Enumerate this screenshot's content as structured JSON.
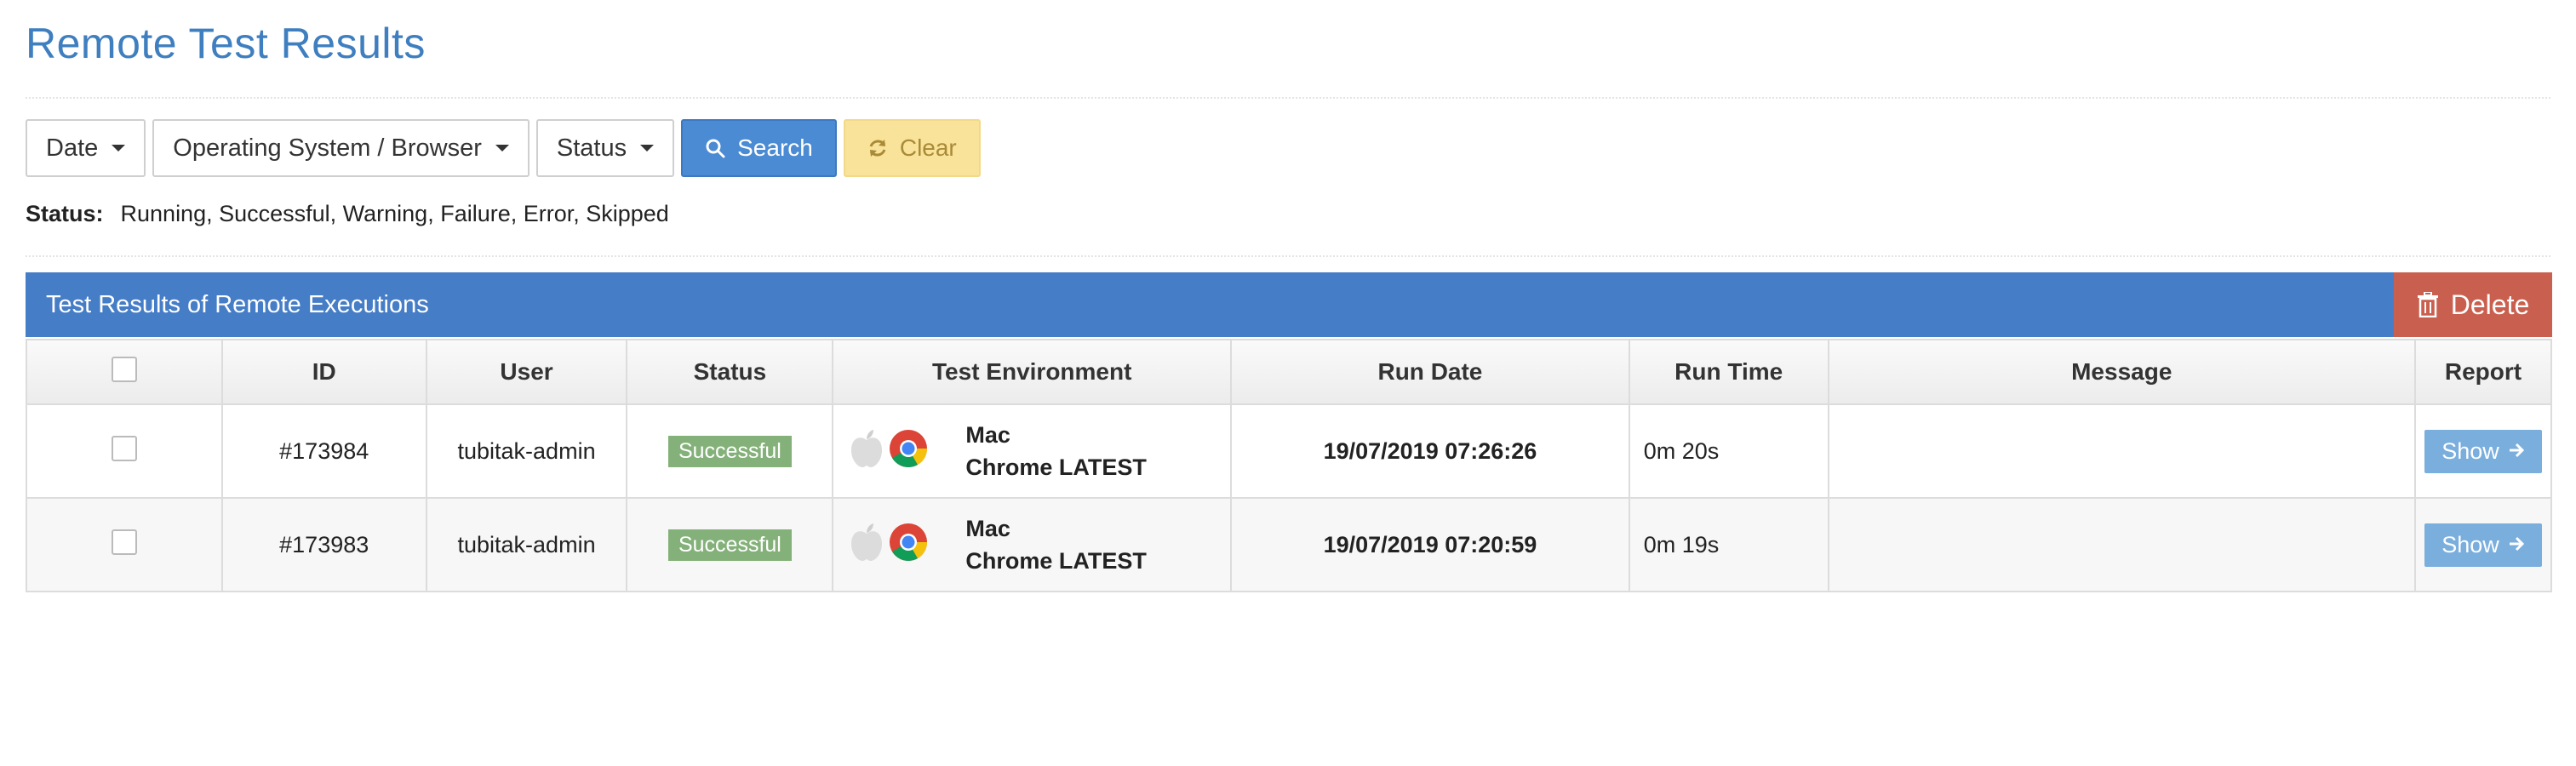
{
  "page": {
    "title": "Remote Test Results"
  },
  "filters": {
    "date_label": "Date",
    "os_browser_label": "Operating System / Browser",
    "status_label": "Status",
    "search_label": "Search",
    "clear_label": "Clear"
  },
  "status_line": {
    "label": "Status:",
    "value": "Running, Successful, Warning, Failure, Error, Skipped"
  },
  "panel": {
    "title": "Test Results of Remote Executions",
    "delete_label": "Delete"
  },
  "table": {
    "headers": [
      "ID",
      "User",
      "Status",
      "Test Environment",
      "Run Date",
      "Run Time",
      "Message",
      "Report"
    ],
    "rows": [
      {
        "id": "#173984",
        "user": "tubitak-admin",
        "status": "Successful",
        "os": "Mac",
        "browser": "Chrome LATEST",
        "run_date": "19/07/2019 07:26:26",
        "run_time": "0m 20s",
        "message": "",
        "report_label": "Show"
      },
      {
        "id": "#173983",
        "user": "tubitak-admin",
        "status": "Successful",
        "os": "Mac",
        "browser": "Chrome LATEST",
        "run_date": "19/07/2019 07:20:59",
        "run_time": "0m 19s",
        "message": "",
        "report_label": "Show"
      }
    ]
  },
  "icons": {
    "os": "apple-icon",
    "browser": "chrome-icon",
    "search": "search-icon",
    "clear": "refresh-icon",
    "delete": "trash-icon",
    "report": "arrow-right-icon"
  },
  "colors": {
    "title": "#3f7fbf",
    "header_bar": "#457dc6",
    "search_button": "#4a8bd3",
    "clear_button": "#f9e39a",
    "delete_button": "#c9604f",
    "success_badge": "#84b179",
    "show_button": "#7aaedd"
  }
}
